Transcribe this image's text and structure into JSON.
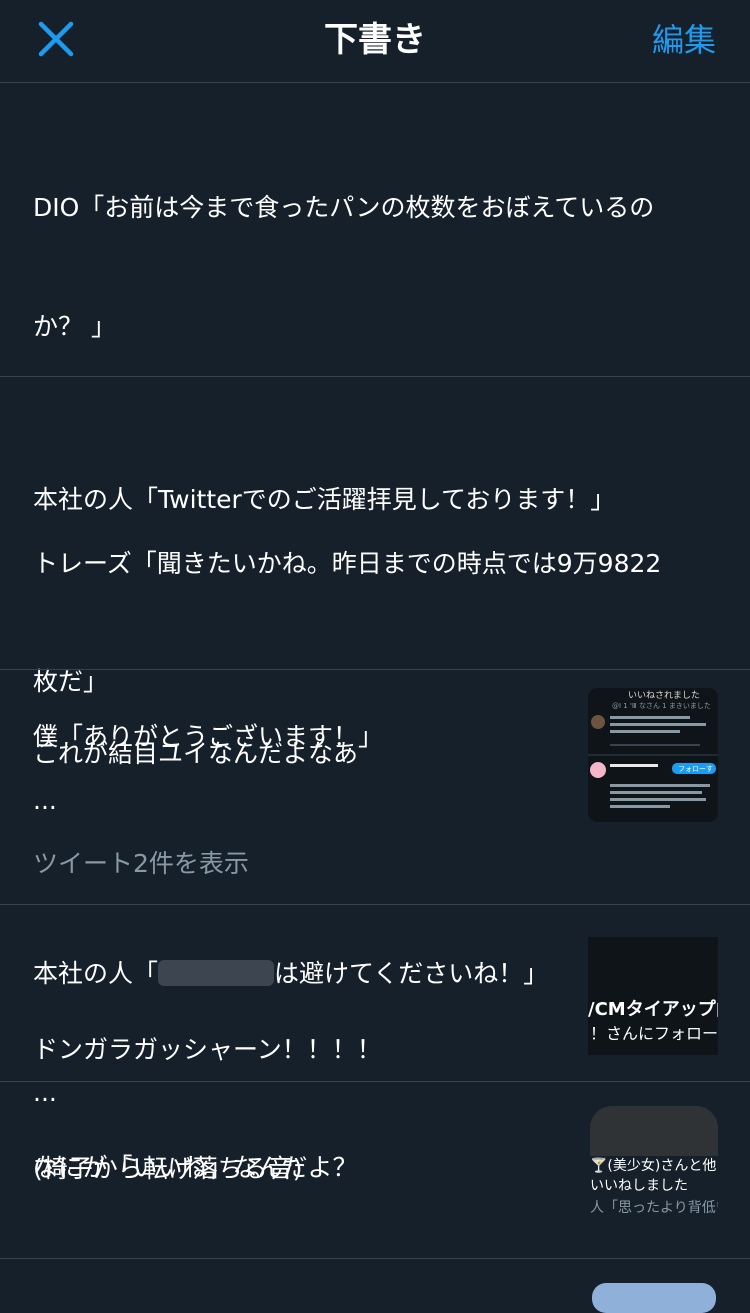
{
  "header": {
    "title": "下書き",
    "edit_label": "編集"
  },
  "drafts": [
    {
      "lines": [
        "DIO「お前は今まで食ったパンの枚数をおぼえているの",
        "か？ 」",
        "",
        "トレーズ「聞きたいかね。昨日までの時点では9万9822",
        "枚だ」",
        "..."
      ]
    },
    {
      "lines": [
        "本社の人「Twitterでのご活躍拝見しております！」",
        "",
        "僕「ありがとうございます！」",
        "",
        "..."
      ],
      "redacted_line_prefix": "本社の人「",
      "redacted_line_suffix": "は避けてくださいね！」"
    },
    {
      "text": "これが結目ユイなんだよなあ",
      "thread_link": "ツイート2件を表示",
      "thumb": {
        "title": "いいねされました",
        "subtitle": "@I 1 'Ⅲ なさん 1 まきいました",
        "follow_label": "フォローす"
      }
    },
    {
      "lines": [
        "ドンガラガッシャーン！！！！",
        "(椅子から転げ落ちる音)"
      ],
      "thumb": {
        "line1": "/CMタイアップ由",
        "line2": "！さんにフォロー"
      }
    },
    {
      "text": "なにが「いいね」なんだよ？",
      "thumb": {
        "line1": "🍸(美少女)さんと他",
        "line2": "いいねしました",
        "line3": "人「思ったより背低い"
      }
    }
  ],
  "colors": {
    "background": "#15202b",
    "divider": "#38444d",
    "accent": "#1d9bf0",
    "muted": "#8899a6"
  }
}
